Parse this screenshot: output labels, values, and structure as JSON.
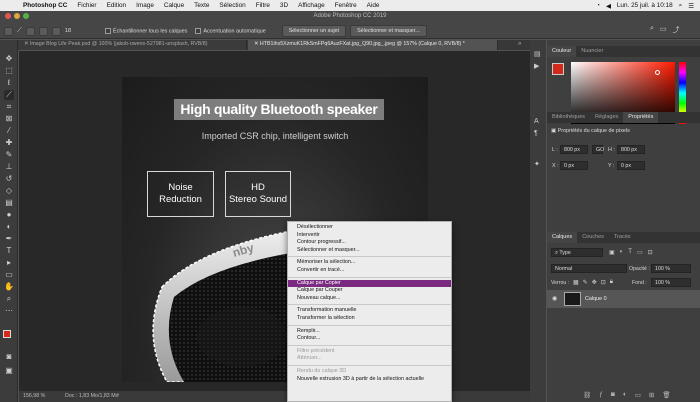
{
  "menubar": {
    "app": "Photoshop CC",
    "items": [
      "Fichier",
      "Edition",
      "Image",
      "Calque",
      "Texte",
      "Sélection",
      "Filtre",
      "3D",
      "Affichage",
      "Fenêtre",
      "Aide"
    ],
    "clock": "Lun. 25 juil. à 10:18"
  },
  "app_title": "Adobe Photoshop CC 2019",
  "options": {
    "brush_size": "18",
    "sample_all_label": "Échantillonner tous les calques",
    "auto_enhance_label": "Accentuation automatique",
    "select_subject": "Sélectionner un sujet",
    "select_mask": "Sélectionner et masquer..."
  },
  "tabs": [
    {
      "label": "Image Blog Life Peak.psd @ 100% (jakob-owens-527981-unsplash, RVB/8)"
    },
    {
      "label": "HTB1ihx5XzmuK1RkSmFPq6AuzFXat.jpg_Q90.jpg_.jpeg @ 157% (Calque 0, RVB/8) *"
    }
  ],
  "document": {
    "title": "High quality Bluetooth speaker",
    "subtitle": "Imported CSR chip, intelligent switch",
    "feature1_l1": "Noise",
    "feature1_l2": "Reduction",
    "feature2_l1": "HD",
    "feature2_l2": "Stereo Sound",
    "brand": "nby"
  },
  "status": {
    "zoom": "156,98 %",
    "doc": "Doc : 1,83 Mo/1,83 Mo"
  },
  "context_menu": [
    {
      "label": "Désélectionner",
      "state": "normal"
    },
    {
      "label": "Intervertir",
      "state": "normal"
    },
    {
      "label": "Contour progressif...",
      "state": "normal"
    },
    {
      "label": "Sélectionner et masquer...",
      "state": "normal"
    },
    {
      "sep": true
    },
    {
      "label": "Mémoriser la sélection...",
      "state": "normal"
    },
    {
      "label": "Convertir en tracé...",
      "state": "normal"
    },
    {
      "sep": true
    },
    {
      "label": "Calque par Copier",
      "state": "highlight"
    },
    {
      "label": "Calque par Couper",
      "state": "normal"
    },
    {
      "label": "Nouveau calque...",
      "state": "normal"
    },
    {
      "sep": true
    },
    {
      "label": "Transformation manuelle",
      "state": "normal"
    },
    {
      "label": "Transformer la sélection",
      "state": "normal"
    },
    {
      "sep": true
    },
    {
      "label": "Remplir...",
      "state": "normal"
    },
    {
      "label": "Contour...",
      "state": "normal"
    },
    {
      "sep": true
    },
    {
      "label": "Filtre précédent",
      "state": "disabled"
    },
    {
      "label": "Atténuer...",
      "state": "disabled"
    },
    {
      "sep": true
    },
    {
      "label": "Rendu du calque 3D",
      "state": "disabled"
    },
    {
      "label": "Nouvelle extrusion 3D à partir de la sélection actuelle",
      "state": "normal"
    }
  ],
  "color_panel": {
    "tab_active": "Couleur",
    "tab2": "Nuancier",
    "fg_color": "#d42a1c"
  },
  "props_panel": {
    "tab1": "Bibliothèques",
    "tab2": "Réglages",
    "tab_active": "Propriétés",
    "header": "Propriétés du calque de pixels",
    "w_label": "L :",
    "w_value": "800 px",
    "h_label": "H :",
    "h_value": "800 px",
    "link_label": "GO",
    "x_label": "X :",
    "x_value": "0 px",
    "y_label": "Y :",
    "y_value": "0 px"
  },
  "layers_panel": {
    "tab_active": "Calques",
    "tab2": "Couches",
    "tab3": "Tracés",
    "filter": "Type",
    "blend": "Normal",
    "opacity_label": "Opacité :",
    "opacity_value": "100 %",
    "lock_label": "Verrou :",
    "fill_label": "Fond :",
    "fill_value": "100 %",
    "layer_name": "Calque 0"
  },
  "colors": {
    "accent_highlight": "#7a2a80"
  }
}
